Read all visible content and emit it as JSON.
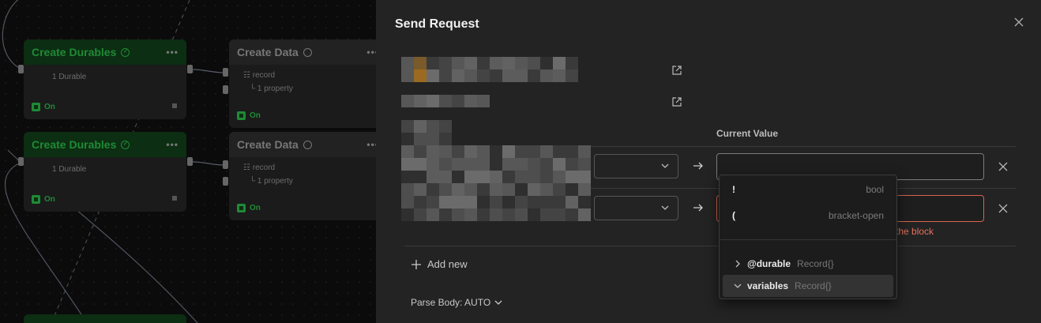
{
  "panel": {
    "title": "Send Request",
    "column_header": "Current Value",
    "rows": [
      {
        "value": "",
        "error": ""
      },
      {
        "value": "",
        "error": "the block"
      }
    ],
    "add_new_label": "Add new",
    "parse_body_label": "Parse Body: AUTO"
  },
  "dropdown": {
    "tokens": [
      {
        "symbol": "!",
        "kind": "bool"
      },
      {
        "symbol": "(",
        "kind": "bracket-open"
      }
    ],
    "tree": [
      {
        "name": "@durable",
        "type": "Record{}",
        "expanded": false
      },
      {
        "name": "variables",
        "type": "Record{}",
        "expanded": true
      }
    ]
  },
  "canvas": {
    "nodes": [
      {
        "title": "Create Durables",
        "line1": "1 Durable",
        "status": "On"
      },
      {
        "title": "Create Data",
        "line1": "record",
        "line2": "1 property",
        "status": "On"
      },
      {
        "title": "Create Durables",
        "line1": "1 Durable",
        "status": "On"
      },
      {
        "title": "Create Data",
        "line1": "record",
        "line2": "1 property",
        "status": "On"
      }
    ]
  },
  "colors": {
    "accent_green": "#1f8a36",
    "error_red": "#e86f5b",
    "panel_bg": "#232323"
  }
}
